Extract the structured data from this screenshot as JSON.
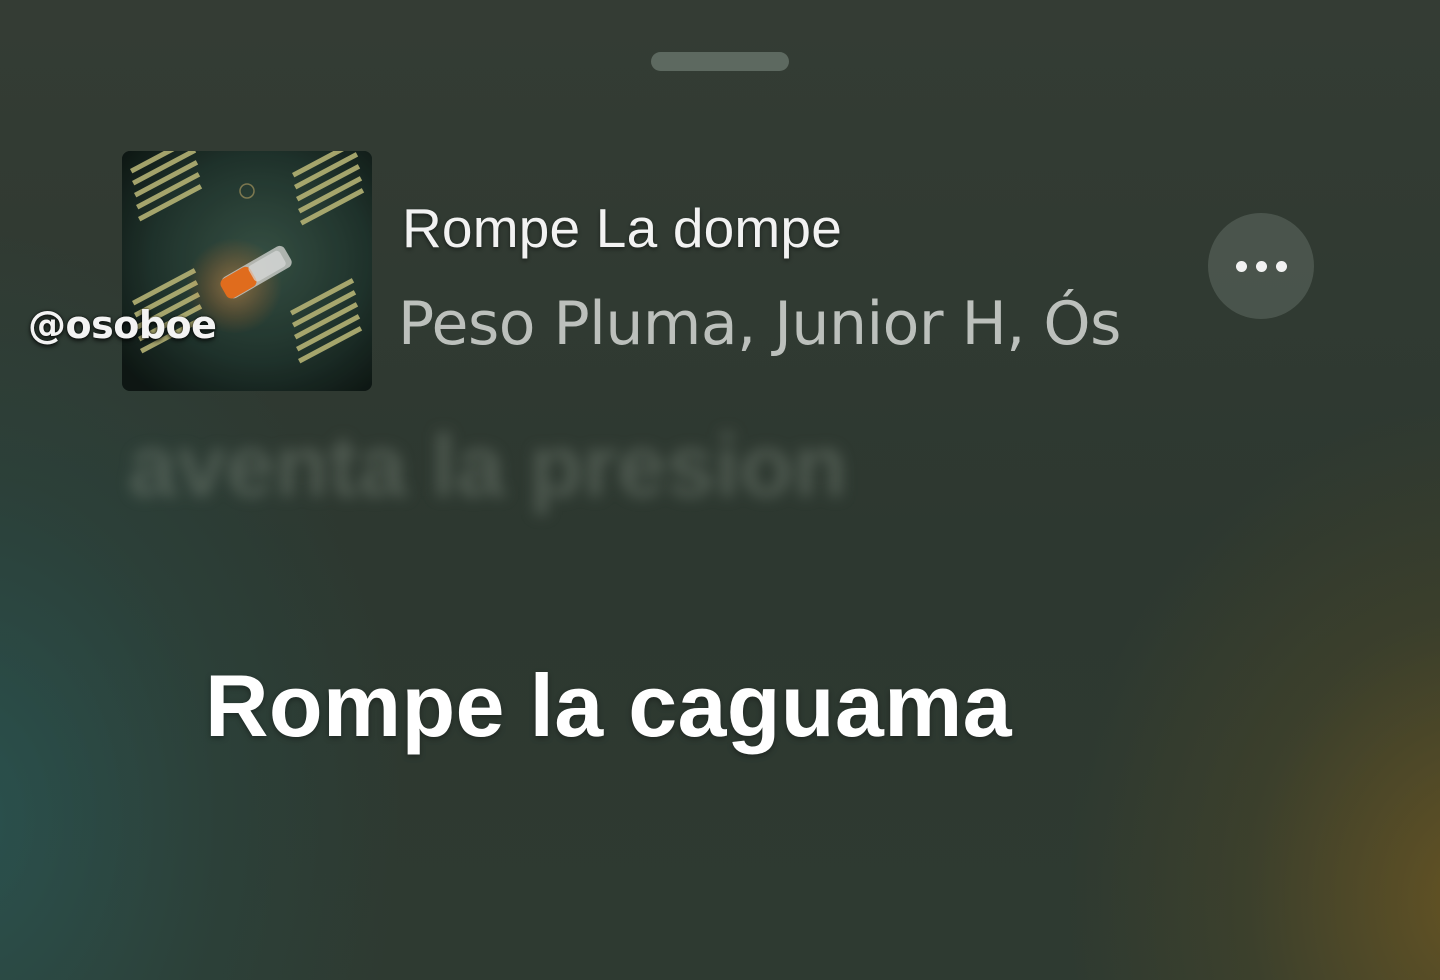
{
  "watermark": "@osoboe",
  "track": {
    "title": "Rompe La dompe",
    "artists": "Peso Pluma, Junior H, Ós"
  },
  "more_button": {
    "icon": "more-horizontal-icon"
  },
  "lyrics": {
    "previous_line": "aventa la presion",
    "current_line": "Rompe la caguama"
  },
  "colors": {
    "text_primary": "#f2f2f2",
    "text_secondary": "#bcc0bc",
    "background": "#2f3a31"
  }
}
